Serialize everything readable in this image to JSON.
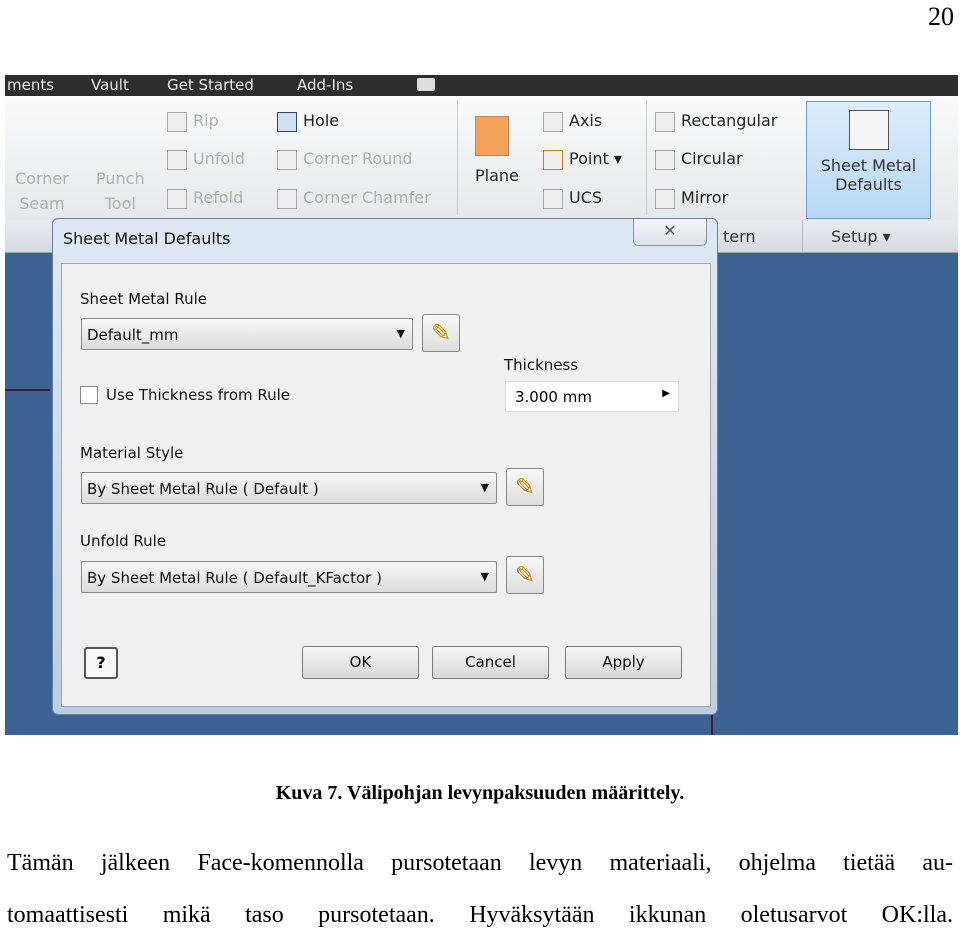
{
  "page_number": "20",
  "screenshot": {
    "menubar": {
      "items": [
        "ments",
        "Vault",
        "Get Started",
        "Add-Ins"
      ]
    },
    "ribbon": {
      "corner_seam": "Corner\nSeam",
      "punch_tool": "Punch\nTool",
      "rip": "Rip",
      "unfold": "Unfold",
      "refold": "Refold",
      "hole": "Hole",
      "corner_round": "Corner Round",
      "corner_chamfer": "Corner Chamfer",
      "plane": "Plane",
      "axis": "Axis",
      "point": "Point",
      "ucs": "UCS",
      "rectangular": "Rectangular",
      "circular": "Circular",
      "mirror": "Mirror",
      "sheet_metal_defaults_1": "Sheet Metal",
      "sheet_metal_defaults_2": "Defaults",
      "panel_pattern": "tern",
      "panel_setup": "Setup"
    },
    "dialog": {
      "title": "Sheet Metal Defaults",
      "close": "✕",
      "sheet_metal_rule_label": "Sheet Metal Rule",
      "sheet_metal_rule_value": "Default_mm",
      "use_thickness_label": "Use Thickness from Rule",
      "use_thickness_checked": false,
      "thickness_label": "Thickness",
      "thickness_value": "3.000 mm",
      "material_style_label": "Material Style",
      "material_style_value": "By Sheet Metal Rule ( Default )",
      "unfold_rule_label": "Unfold Rule",
      "unfold_rule_value": "By Sheet Metal Rule ( Default_KFactor )",
      "help": "?",
      "ok": "OK",
      "cancel": "Cancel",
      "apply": "Apply"
    }
  },
  "caption": "Kuva 7. Välipohjan levynpaksuuden määrittely.",
  "paragraph_line1": "Tämän jälkeen Face-komennolla pursotetaan levyn materiaali, ohjelma tietää au-",
  "paragraph_line2": "tomaattisesti mikä taso pursotetaan. Hyväksytään ikkunan oletusarvot OK:lla."
}
